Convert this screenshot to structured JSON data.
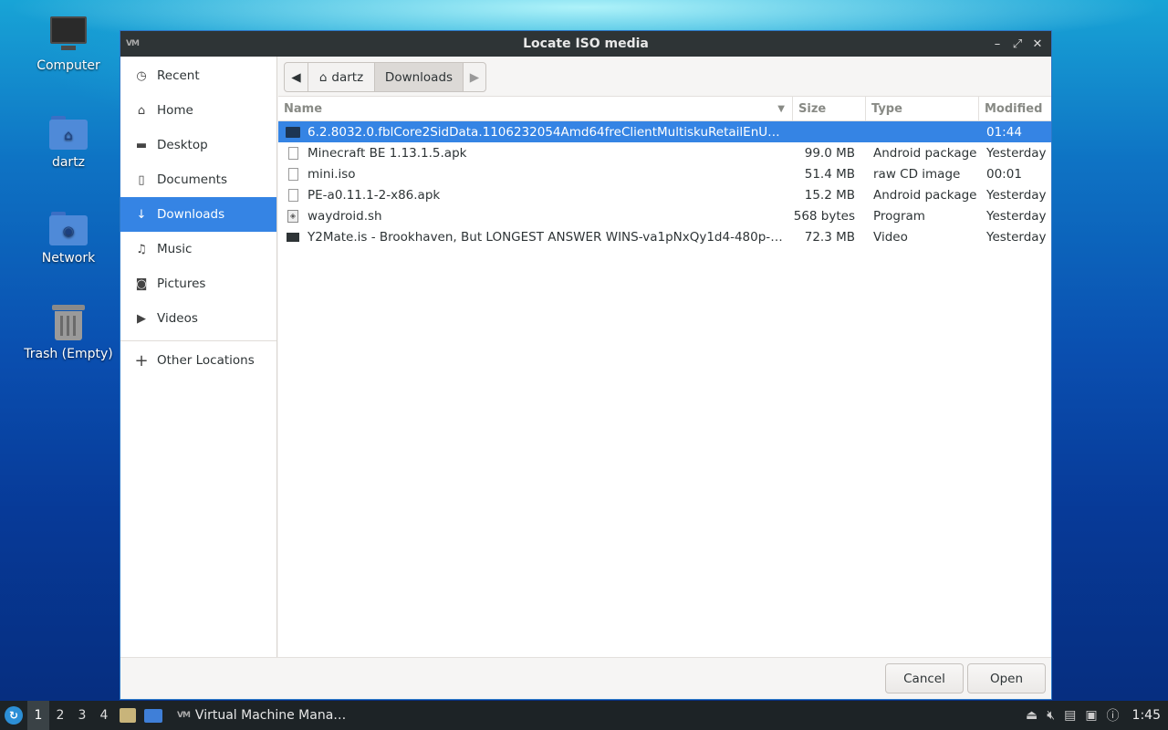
{
  "desktop": {
    "icons": [
      {
        "label": "Computer"
      },
      {
        "label": "dartz"
      },
      {
        "label": "Network"
      },
      {
        "label": "Trash (Empty)"
      }
    ]
  },
  "dialog": {
    "title": "Locate ISO media",
    "sidebar": {
      "items": [
        {
          "label": "Recent",
          "icon": "clock-icon"
        },
        {
          "label": "Home",
          "icon": "home-icon"
        },
        {
          "label": "Desktop",
          "icon": "folder-icon"
        },
        {
          "label": "Documents",
          "icon": "document-icon"
        },
        {
          "label": "Downloads",
          "icon": "download-icon",
          "active": true
        },
        {
          "label": "Music",
          "icon": "music-icon"
        },
        {
          "label": "Pictures",
          "icon": "camera-icon"
        },
        {
          "label": "Videos",
          "icon": "video-icon"
        }
      ],
      "other_locations": "Other Locations"
    },
    "pathbar": {
      "home": "dartz",
      "current": "Downloads"
    },
    "columns": {
      "name": "Name",
      "size": "Size",
      "type": "Type",
      "modified": "Modified"
    },
    "files": [
      {
        "name": "6.2.8032.0.fblCore2SidData.1106232054Amd64freClientMultiskuRetailEnUsHM…",
        "size": "",
        "type": "",
        "modified": "01:44",
        "icon": "folder-icon",
        "selected": true
      },
      {
        "name": "Minecraft BE 1.13.1.5.apk",
        "size": "99.0 MB",
        "type": "Android package",
        "modified": "Yesterday",
        "icon": "file-icon"
      },
      {
        "name": "mini.iso",
        "size": "51.4 MB",
        "type": "raw CD image",
        "modified": "00:01",
        "icon": "file-icon"
      },
      {
        "name": "PE-a0.11.1-2-x86.apk",
        "size": "15.2 MB",
        "type": "Android package",
        "modified": "Yesterday",
        "icon": "file-icon"
      },
      {
        "name": "waydroid.sh",
        "size": "568 bytes",
        "type": "Program",
        "modified": "Yesterday",
        "icon": "script-icon"
      },
      {
        "name": "Y2Mate.is - Brookhaven, But LONGEST ANSWER WINS-va1pNxQy1d4-480p-165…",
        "size": "72.3 MB",
        "type": "Video",
        "modified": "Yesterday",
        "icon": "video-file-icon"
      }
    ],
    "buttons": {
      "cancel": "Cancel",
      "open": "Open"
    }
  },
  "taskbar": {
    "workspaces": [
      "1",
      "2",
      "3",
      "4"
    ],
    "active_workspace": "1",
    "task_label": "Virtual Machine Mana…",
    "clock": "1:45"
  },
  "colors": {
    "accent": "#3584e4",
    "titlebar": "#2e3436",
    "taskbar": "#1d2326"
  }
}
